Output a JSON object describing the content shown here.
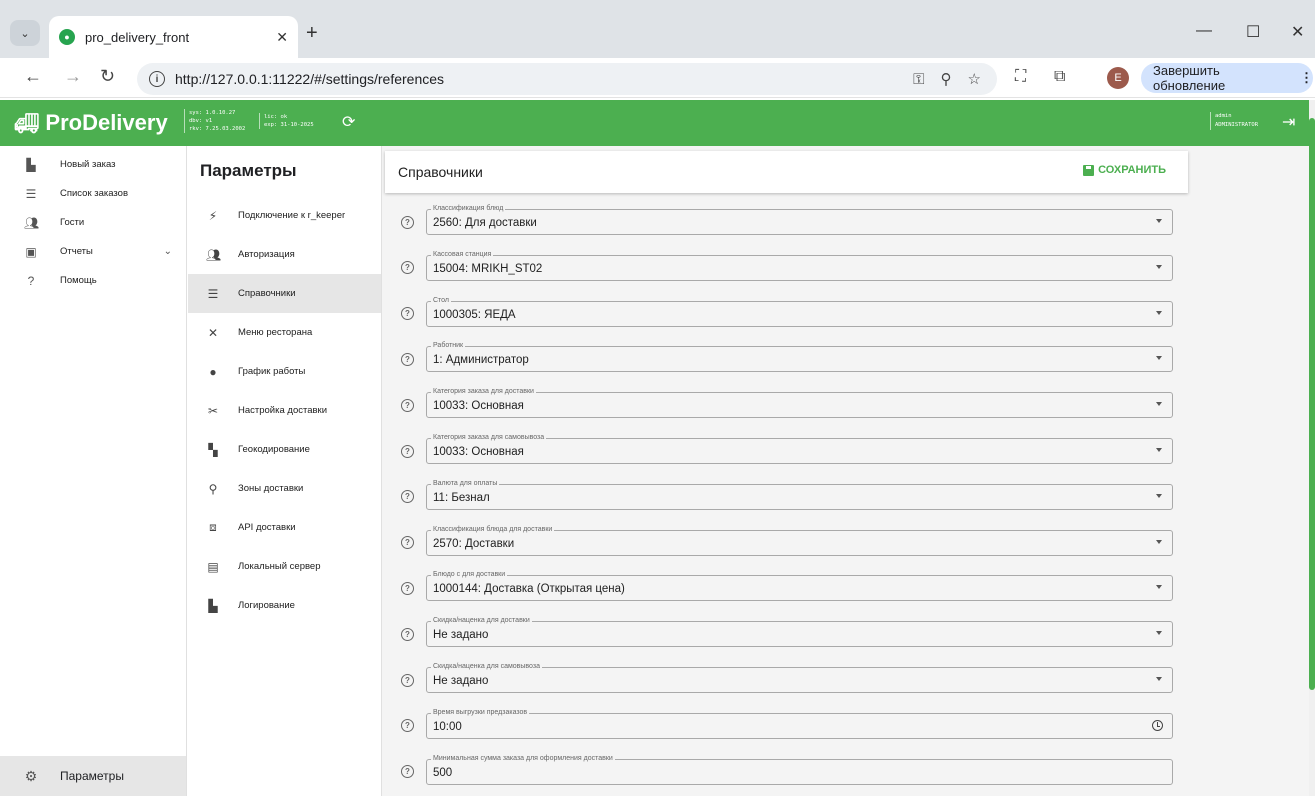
{
  "browser": {
    "tab_title": "pro_delivery_front",
    "url": "http://127.0.0.1:11222/#/settings/references",
    "update_label": "Завершить обновление",
    "profile_initial": "E"
  },
  "header": {
    "logo": "ProDelivery",
    "version_lines": [
      "sys: 1.0.10.27",
      "dbv: v1",
      "rkv: 7.25.03.2002"
    ],
    "license_lines": [
      "lic: ok",
      "exp: 31-10-2025"
    ],
    "user_lines": [
      "admin",
      "ADMINISTRATOR"
    ]
  },
  "sidebar": {
    "items": [
      {
        "label": "Новый заказ",
        "icon": "new-order-icon"
      },
      {
        "label": "Список заказов",
        "icon": "list-icon"
      },
      {
        "label": "Гости",
        "icon": "guests-icon"
      },
      {
        "label": "Отчеты",
        "icon": "reports-icon"
      },
      {
        "label": "Помощь",
        "icon": "help-icon"
      }
    ],
    "bottom_label": "Параметры"
  },
  "settings_menu": {
    "title": "Параметры",
    "items": [
      {
        "label": "Подключение к r_keeper",
        "icon": "plug-icon"
      },
      {
        "label": "Авторизация",
        "icon": "users-icon"
      },
      {
        "label": "Справочники",
        "icon": "list-icon",
        "active": true
      },
      {
        "label": "Меню ресторана",
        "icon": "utensils-icon"
      },
      {
        "label": "График работы",
        "icon": "clock-icon"
      },
      {
        "label": "Настройка доставки",
        "icon": "delivery-settings-icon"
      },
      {
        "label": "Геокодирование",
        "icon": "map-search-icon"
      },
      {
        "label": "Зоны доставки",
        "icon": "location-icon"
      },
      {
        "label": "API доставки",
        "icon": "api-icon"
      },
      {
        "label": "Локальный сервер",
        "icon": "server-icon"
      },
      {
        "label": "Логирование",
        "icon": "log-icon"
      }
    ]
  },
  "main": {
    "title": "Справочники",
    "save_label": "СОХРАНИТЬ",
    "fields": [
      {
        "label": "Классификация блюд",
        "value": "2560: Для доставки",
        "type": "select"
      },
      {
        "label": "Кассовая станция",
        "value": "15004: MRIKH_ST02",
        "type": "select"
      },
      {
        "label": "Стол",
        "value": "1000305: ЯЕДА",
        "type": "select"
      },
      {
        "label": "Работник",
        "value": "1: Администратор",
        "type": "select"
      },
      {
        "label": "Категория заказа для доставки",
        "value": "10033: Основная",
        "type": "select"
      },
      {
        "label": "Категория заказа для самовывоза",
        "value": "10033: Основная",
        "type": "select"
      },
      {
        "label": "Валюта для оплаты",
        "value": "11: Безнал",
        "type": "select"
      },
      {
        "label": "Классификация блюда для доставки",
        "value": "2570: Доставки",
        "type": "select"
      },
      {
        "label": "Блюдо с для доставки",
        "value": "1000144: Доставка (Открытая цена)",
        "type": "select"
      },
      {
        "label": "Скидка/наценка для доставки",
        "value": "Не задано",
        "type": "select"
      },
      {
        "label": "Скидка/наценка для самовывоза",
        "value": "Не задано",
        "type": "select"
      },
      {
        "label": "Время выгрузки предзаказов",
        "value": "10:00",
        "type": "time"
      },
      {
        "label": "Минимальная сумма заказа для оформления доставки",
        "value": "500",
        "type": "text"
      }
    ]
  }
}
